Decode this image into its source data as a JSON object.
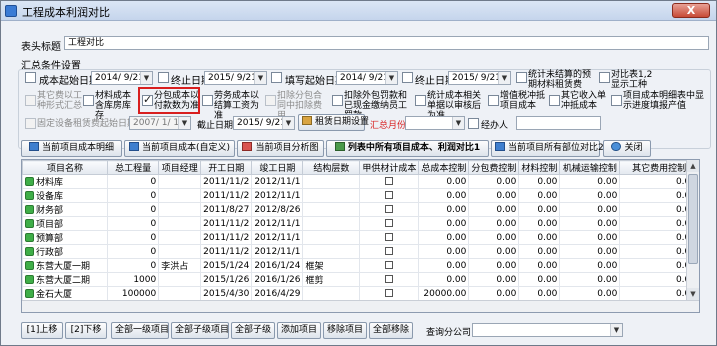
{
  "window": {
    "title": "工程成本利润对比",
    "close_glyph": "X"
  },
  "table_title": {
    "label": "表头标题",
    "value": "工程对比"
  },
  "summary": {
    "group_label": "汇总条件设置",
    "row1": [
      {
        "label": "成本起始日期",
        "date": "2014/ 9/21",
        "checked": false
      },
      {
        "label": "终止日期",
        "date": "2015/ 9/21",
        "checked": false
      },
      {
        "label": "填写起始日期",
        "date": "2014/ 9/21",
        "checked": false
      },
      {
        "label": "终止日期",
        "date": "2015/ 9/21",
        "checked": false
      }
    ],
    "row1_extra": [
      {
        "label": "统计未结算的预期材料租赁费",
        "checked": false
      },
      {
        "label": "对比表1,2显示工种",
        "checked": false
      }
    ],
    "row2": [
      {
        "label": "其它费以工种形式汇总",
        "checked": false,
        "disabled": true
      },
      {
        "label": "材料成本含库房库存",
        "checked": false,
        "disabled": false
      },
      {
        "label": "分包成本以付款数为准",
        "checked": true,
        "disabled": false
      },
      {
        "label": "劳务成本以结算工资为准",
        "checked": false,
        "disabled": false
      },
      {
        "label": "扣除分包合同中扣除费用",
        "checked": false,
        "disabled": true
      },
      {
        "label": "扣除外包罚款和已现金缴纳员工罚款",
        "checked": false,
        "disabled": false
      },
      {
        "label": "统计成本相关单据以审核后为准",
        "checked": false,
        "disabled": false
      },
      {
        "label": "增值税冲抵项目成本",
        "checked": false,
        "disabled": false
      },
      {
        "label": "其它收入单冲抵成本",
        "checked": false,
        "disabled": false
      },
      {
        "label": "项目成本明细表中显示进度填报产值",
        "checked": false,
        "disabled": false
      }
    ],
    "row3": {
      "fixed_rent_label": "固定设备租赁费起始日期",
      "fixed_rent_date": "2007/ 1/ 1",
      "end_label": "截止日期",
      "end_date": "2015/ 9/21",
      "rent_btn": "租赁日期设置",
      "month_label": "汇总月份",
      "manager_label": "经办人",
      "manager_value": ""
    }
  },
  "toolbar": [
    {
      "label": "当前项目成本明细",
      "icon": "report-icon",
      "bold": false
    },
    {
      "label": "当前项目成本(自定义)",
      "icon": "report-icon",
      "bold": false
    },
    {
      "label": "当前项目分析图",
      "icon": "chart-icon",
      "bold": false
    },
    {
      "label": "列表中所有项目成本、利润对比1",
      "icon": "list-icon",
      "bold": true
    },
    {
      "label": "当前项目所有部位对比2",
      "icon": "compare-icon",
      "bold": false
    },
    {
      "label": "关闭",
      "icon": "close-icon",
      "bold": false
    }
  ],
  "grid": {
    "columns": [
      "项目名称",
      "总工程量",
      "项目经理",
      "开工日期",
      "竣工日期",
      "结构层数",
      "甲供材计成本",
      "总成本控制",
      "分包费控制",
      "材料控制",
      "机械运输控制",
      "其它费用控制"
    ],
    "rows": [
      [
        "材料库",
        "0",
        "",
        "2011/11/2",
        "2012/11/1",
        "",
        "",
        "0.00",
        "0.00",
        "0.00",
        "0.00",
        "0.00"
      ],
      [
        "设备库",
        "0",
        "",
        "2011/11/2",
        "2012/11/1",
        "",
        "",
        "0.00",
        "0.00",
        "0.00",
        "0.00",
        "0.00"
      ],
      [
        "财务部",
        "0",
        "",
        "2011/8/27",
        "2012/8/26",
        "",
        "",
        "0.00",
        "0.00",
        "0.00",
        "0.00",
        "0.00"
      ],
      [
        "项目部",
        "0",
        "",
        "2011/11/2",
        "2012/11/1",
        "",
        "",
        "0.00",
        "0.00",
        "0.00",
        "0.00",
        "0.00"
      ],
      [
        "预算部",
        "0",
        "",
        "2011/11/2",
        "2012/11/1",
        "",
        "",
        "0.00",
        "0.00",
        "0.00",
        "0.00",
        "0.00"
      ],
      [
        "行政部",
        "0",
        "",
        "2011/11/2",
        "2012/11/1",
        "",
        "",
        "0.00",
        "0.00",
        "0.00",
        "0.00",
        "0.00"
      ],
      [
        "东营大厦一期",
        "0",
        "李洪占",
        "2015/1/24",
        "2016/1/24",
        "框架",
        "",
        "0.00",
        "0.00",
        "0.00",
        "0.00",
        "0.00"
      ],
      [
        "东营大厦二期",
        "1000",
        "",
        "2015/1/26",
        "2016/1/26",
        "框剪",
        "",
        "0.00",
        "0.00",
        "0.00",
        "0.00",
        "0.00"
      ],
      [
        "金石大厦",
        "100000",
        "",
        "2015/4/30",
        "2016/4/29",
        "",
        "",
        "20000.00",
        "0.00",
        "0.00",
        "0.00",
        "0.00"
      ],
      [
        "测试1",
        "0",
        "赵一",
        "2015/5/14",
        "2016/5/13",
        "",
        "",
        "1.00",
        "0.00",
        "0.00",
        "0.00",
        "0.00"
      ],
      [
        "金石大楼",
        "0",
        "",
        "2015/5/13",
        "2016/5/12",
        "",
        "",
        "0.00",
        "0.00",
        "0.00",
        "0.00",
        "0.00"
      ]
    ]
  },
  "bottom": {
    "buttons": [
      "[1]上移",
      "[2]下移",
      "全部一级项目",
      "全部子级项目",
      "全部子级",
      "添加项目",
      "移除项目",
      "全部移除"
    ],
    "query_label": "查询分公司",
    "query_value": ""
  }
}
